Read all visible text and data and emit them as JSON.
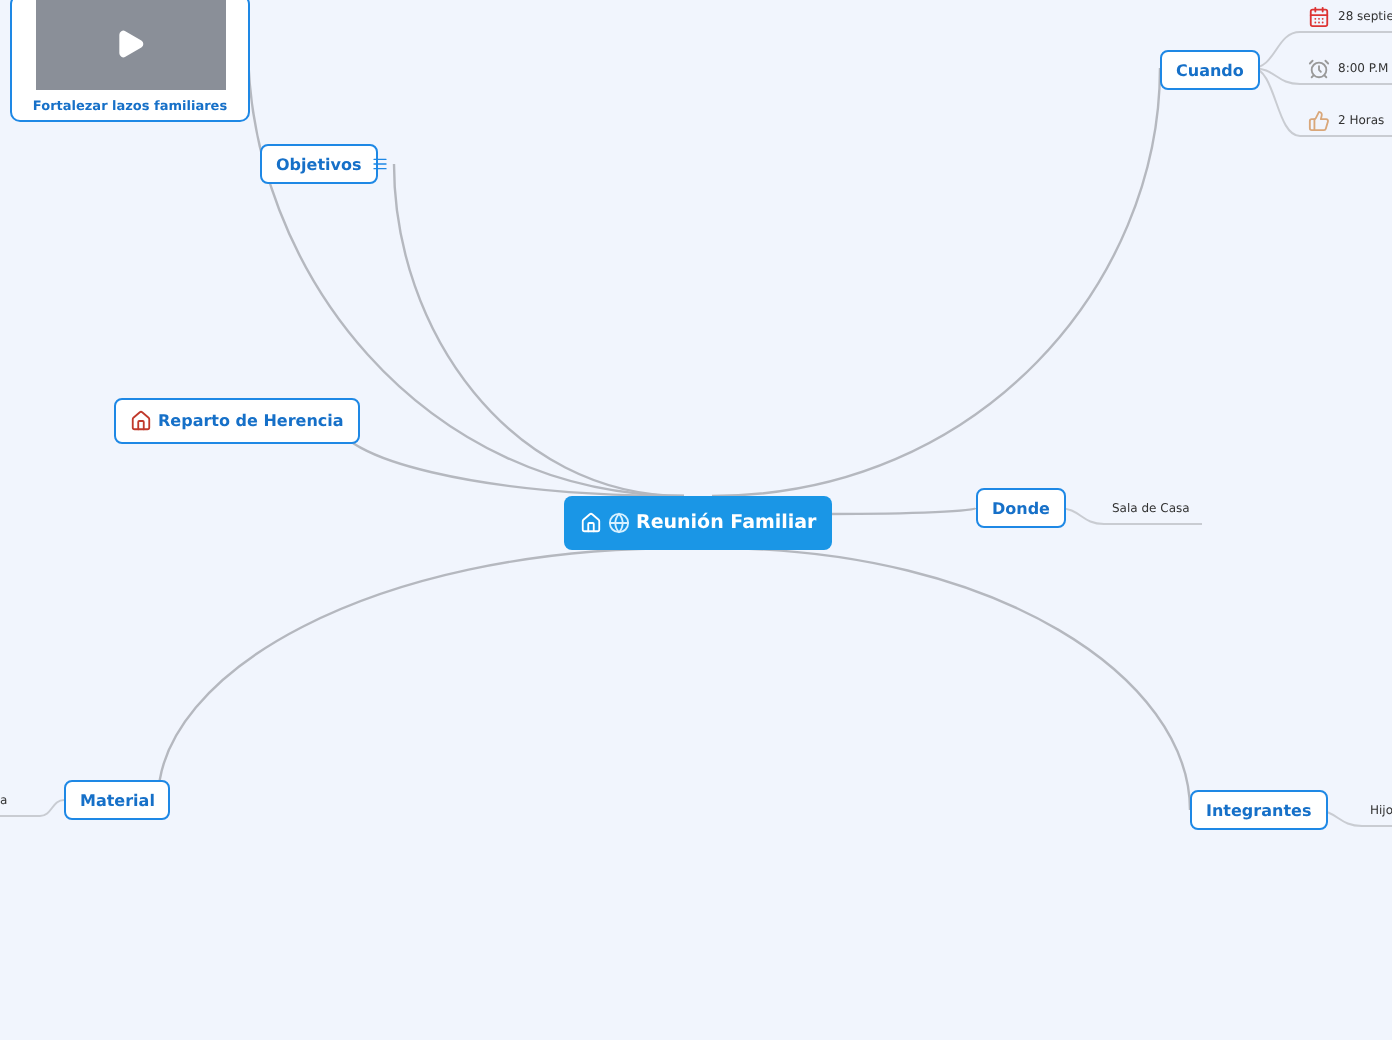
{
  "central": {
    "title": "Reunión Familiar"
  },
  "topics": [
    {
      "kind": "media",
      "label": "Fortalezar lazos familiares"
    },
    {
      "kind": "notes",
      "label": "Objetivos"
    },
    {
      "kind": "house",
      "label": "Reparto de Herencia"
    },
    {
      "kind": "plain",
      "label": "Cuando",
      "children": [
        {
          "kind": "date",
          "label": "28 septie"
        },
        {
          "kind": "time",
          "label": "8:00 P.M"
        },
        {
          "kind": "duration",
          "label": "2 Horas"
        }
      ]
    },
    {
      "kind": "plain",
      "label": "Donde",
      "children": [
        {
          "kind": "text",
          "label": "Sala de Casa"
        }
      ]
    },
    {
      "kind": "plain",
      "label": "Material",
      "children": [
        {
          "kind": "text",
          "label": "a"
        }
      ]
    },
    {
      "kind": "plain",
      "label": "Integrantes",
      "children": [
        {
          "kind": "text",
          "label": "Hijo"
        }
      ]
    }
  ]
}
